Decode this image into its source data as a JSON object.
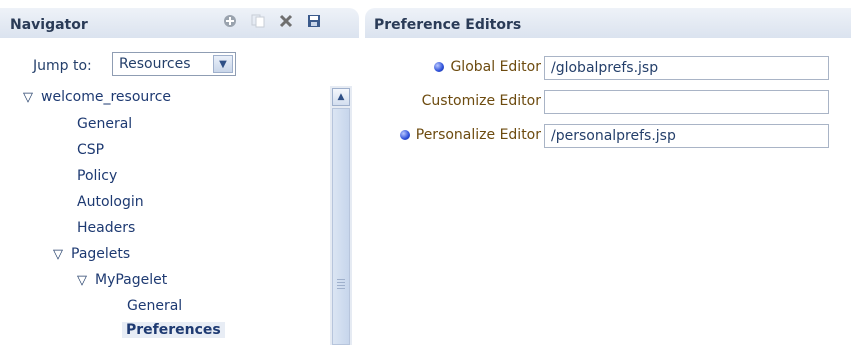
{
  "navigator": {
    "title": "Navigator",
    "tools": [
      "add-icon",
      "copy-icon",
      "delete-icon",
      "save-icon"
    ],
    "jump": {
      "label": "Jump to:",
      "value": "Resources"
    },
    "tree": [
      {
        "label": "welcome_resource",
        "level": 0,
        "expanded": true,
        "selected": false
      },
      {
        "label": "General",
        "level": 1,
        "selected": false
      },
      {
        "label": "CSP",
        "level": 1,
        "selected": false
      },
      {
        "label": "Policy",
        "level": 1,
        "selected": false
      },
      {
        "label": "Autologin",
        "level": 1,
        "selected": false
      },
      {
        "label": "Headers",
        "level": 1,
        "selected": false
      },
      {
        "label": "Pagelets",
        "level": 1,
        "expanded": true,
        "selected": false
      },
      {
        "label": "MyPagelet",
        "level": 2,
        "expanded": true,
        "selected": false
      },
      {
        "label": "General",
        "level": 3,
        "selected": false
      },
      {
        "label": "Preferences",
        "level": 3,
        "selected": true
      }
    ]
  },
  "preference_editors": {
    "title": "Preference Editors",
    "rows": [
      {
        "label": "Global Editor",
        "value": "/globalprefs.jsp",
        "required_dot": true
      },
      {
        "label": "Customize Editor",
        "value": "",
        "required_dot": false
      },
      {
        "label": "Personalize Editor",
        "value": "/personalprefs.jsp",
        "required_dot": true
      }
    ]
  },
  "colors": {
    "accent": "#2c4fd9",
    "label_brown": "#6d4b0f",
    "text_blue": "#1e3a72",
    "header_bg": "#dbe3ef"
  }
}
